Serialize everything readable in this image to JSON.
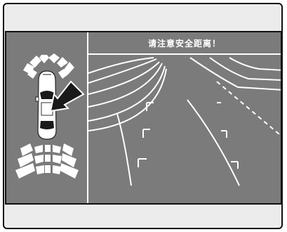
{
  "warning": {
    "text": "请注意安全距离！"
  },
  "colors": {
    "screen_bg": "#7b7b7b",
    "lines": "#ffffff",
    "car_dark": "#1a1a1a"
  },
  "icons": {
    "car": "car-top-view-icon",
    "arrow": "direction-arrow-icon",
    "front_sensors": "front-parking-sensor-icon",
    "rear_sensors": "rear-parking-sensor-icon"
  }
}
